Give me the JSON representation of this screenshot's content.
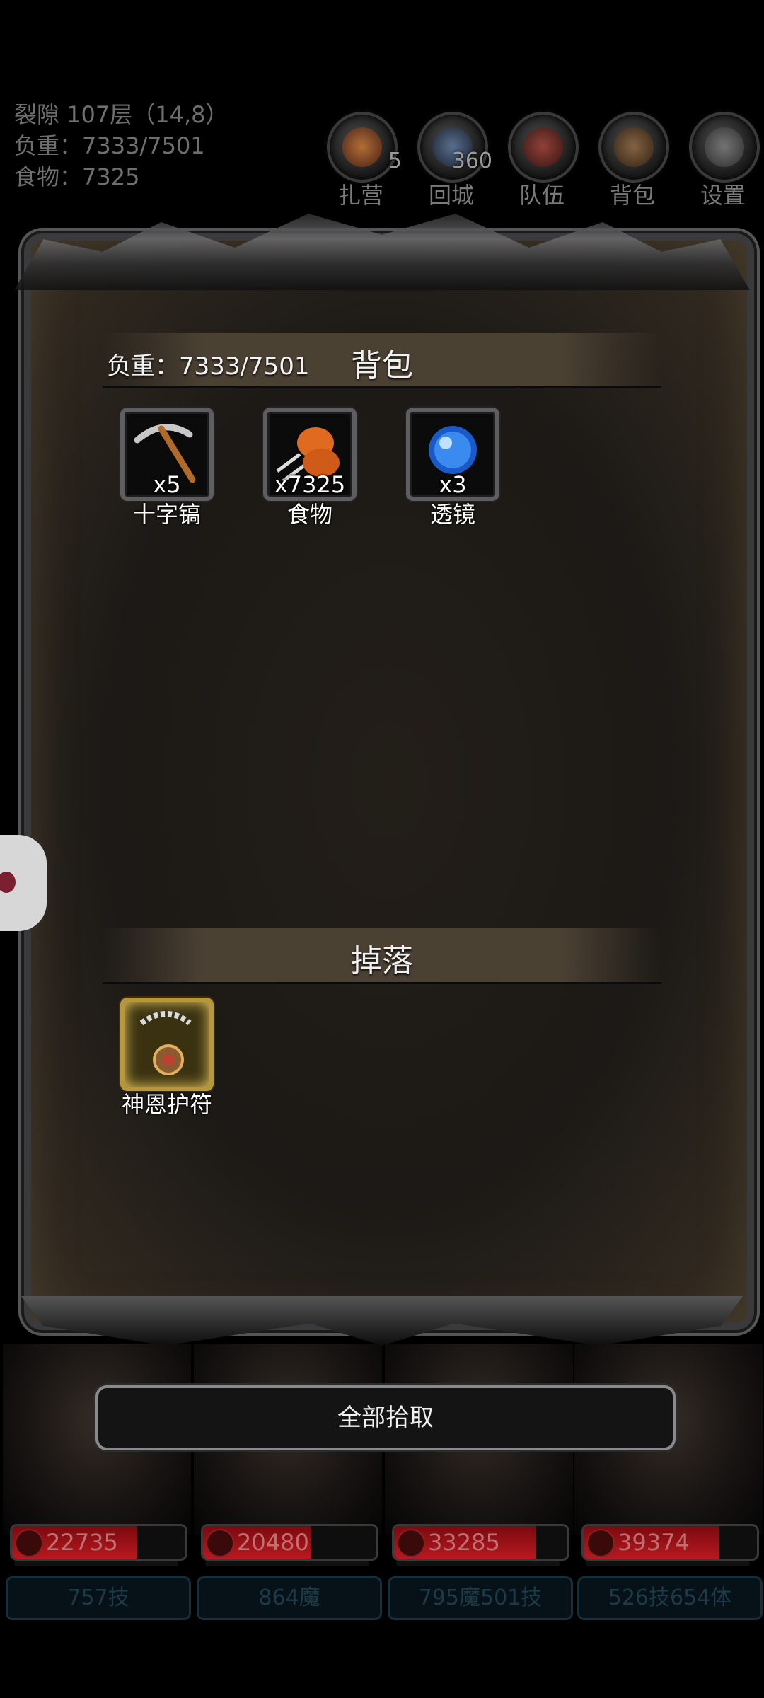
{
  "hud": {
    "location": "裂隙 107层（14,8）",
    "weight": "负重：7333/7501",
    "food": "食物：7325"
  },
  "top_buttons": [
    {
      "label": "扎营",
      "icon": "campfire-icon",
      "badge": "5"
    },
    {
      "label": "回城",
      "icon": "portal-icon",
      "badge": "360"
    },
    {
      "label": "队伍",
      "icon": "team-icon",
      "badge": ""
    },
    {
      "label": "背包",
      "icon": "backpack-icon",
      "badge": ""
    },
    {
      "label": "设置",
      "icon": "gear-icon",
      "badge": ""
    }
  ],
  "backpack": {
    "weight": "负重：7333/7501",
    "title": "背包",
    "items": [
      {
        "name": "十字镐",
        "count": "x5",
        "icon": "pickaxe-icon"
      },
      {
        "name": "食物",
        "count": "x7325",
        "icon": "food-icon"
      },
      {
        "name": "透镜",
        "count": "x3",
        "icon": "lens-icon"
      }
    ]
  },
  "drops": {
    "title": "掉落",
    "items": [
      {
        "name": "神恩护符",
        "count": "",
        "icon": "amulet-icon"
      }
    ]
  },
  "pickup_all": "全部拾取",
  "heroes": [
    {
      "hp": "22735",
      "hp_fill": 0.72,
      "stat": "757技"
    },
    {
      "hp": "20480",
      "hp_fill": 0.62,
      "stat": "864魔"
    },
    {
      "hp": "33285",
      "hp_fill": 0.82,
      "stat": "795魔501技"
    },
    {
      "hp": "39374",
      "hp_fill": 0.78,
      "stat": "526技654体"
    }
  ]
}
